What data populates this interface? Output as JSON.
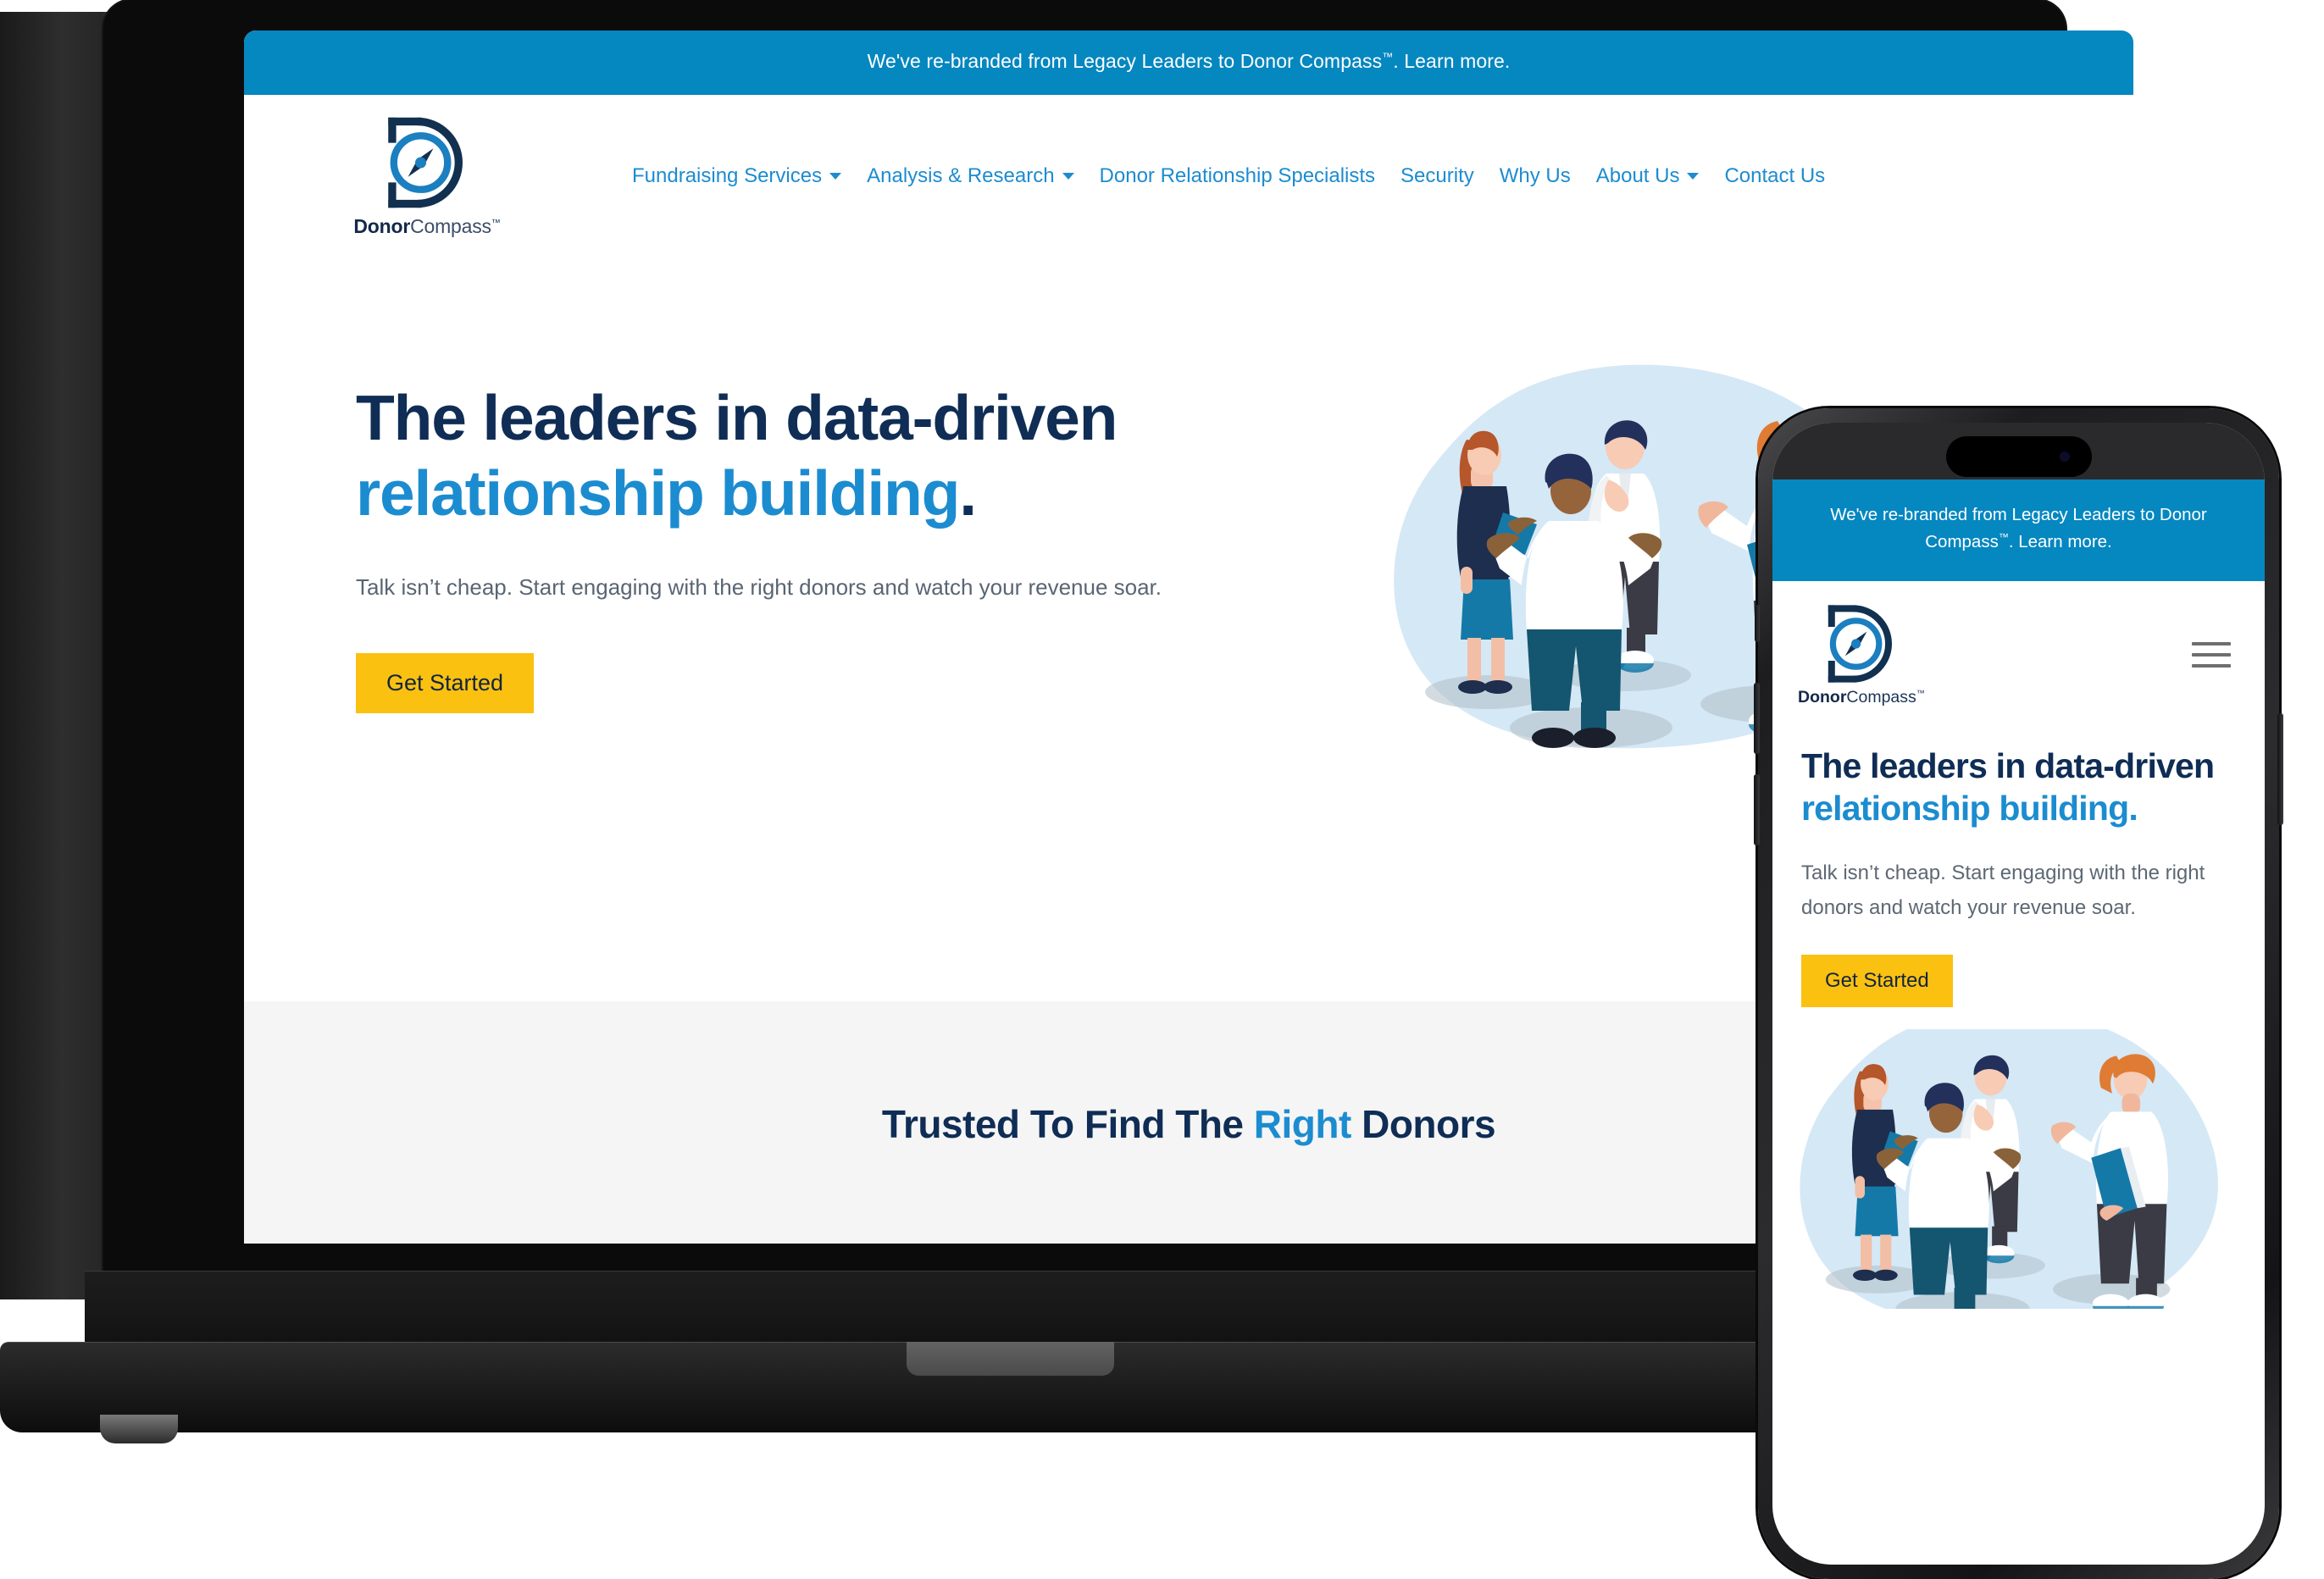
{
  "brand": {
    "name_bold": "Donor",
    "name_light": "Compass",
    "trademark": "™",
    "colors": {
      "primary_blue": "#0587c0",
      "link_blue": "#1c8cd0",
      "navy": "#0f2d55",
      "cta_yellow": "#fbc111",
      "section_gray": "#f5f5f5"
    }
  },
  "announcement": {
    "text_before": "We've re-branded from Legacy Leaders to Donor Compass",
    "trademark": "™",
    "text_after": ". Learn more."
  },
  "nav": {
    "items": [
      {
        "label": "Fundraising Services",
        "has_dropdown": true
      },
      {
        "label": "Analysis & Research",
        "has_dropdown": true
      },
      {
        "label": "Donor Relationship Specialists",
        "has_dropdown": false
      },
      {
        "label": "Security",
        "has_dropdown": false
      },
      {
        "label": "Why Us",
        "has_dropdown": false
      },
      {
        "label": "About Us",
        "has_dropdown": true
      },
      {
        "label": "Contact Us",
        "has_dropdown": false
      }
    ]
  },
  "hero": {
    "heading_line1": "The leaders in data-driven",
    "heading_accent": "relationship building",
    "heading_period": ".",
    "subheading": "Talk isn’t cheap. Start engaging with the right donors and watch your revenue soar.",
    "cta_label": "Get Started",
    "illustration_name": "group-of-people-talking-illustration"
  },
  "trusted_section": {
    "heading_before": "Trusted To Find The ",
    "heading_accent": "Right",
    "heading_after": " Donors"
  },
  "mobile": {
    "heading_line1": "The leaders in data-",
    "heading_line2_dark": "driven ",
    "heading_accent": "relationship building",
    "heading_period": ".",
    "subheading": "Talk isn’t cheap. Start engaging with the right donors and watch your revenue soar.",
    "cta_label": "Get Started",
    "menu_icon": "hamburger-menu-icon"
  }
}
